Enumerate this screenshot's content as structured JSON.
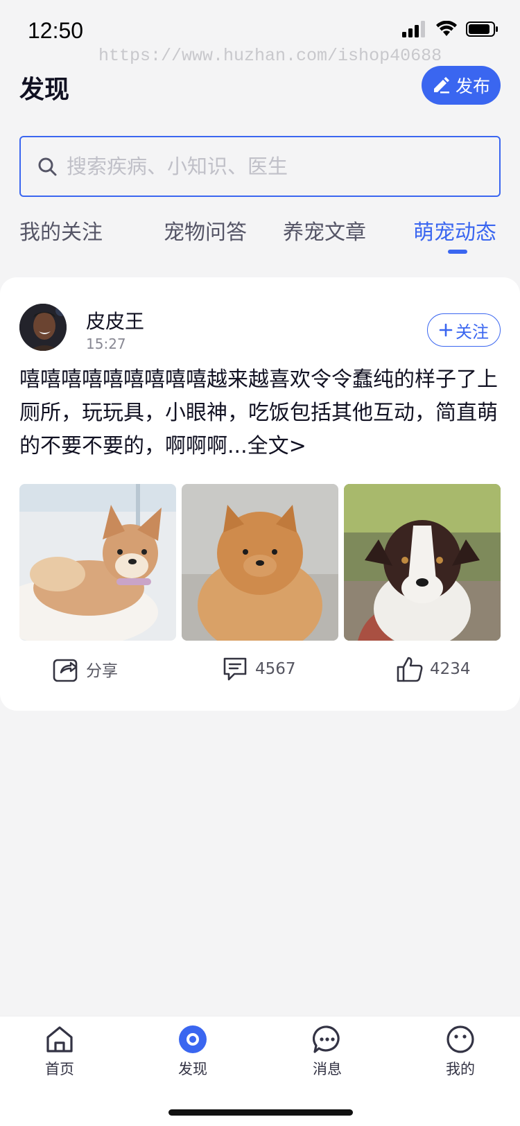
{
  "status_bar": {
    "time": "12:50"
  },
  "watermark": "https://www.huzhan.com/ishop40688",
  "header": {
    "title": "发现",
    "publish_label": "发布"
  },
  "search": {
    "placeholder": "搜索疾病、小知识、医生"
  },
  "tabs": [
    {
      "label": "我的关注",
      "active": false
    },
    {
      "label": "宠物问答",
      "active": false
    },
    {
      "label": "养宠文章",
      "active": false
    },
    {
      "label": "萌宠动态",
      "active": true
    }
  ],
  "post": {
    "author": "皮皮王",
    "time": "15:27",
    "follow_label": "关注",
    "text": "嘻嘻嘻嘻嘻嘻嘻嘻嘻越来越喜欢令令蠢纯的样子了上厕所，玩玩具，小眼神，吃饭包括其他互动，简直萌的不要不要的，啊啊啊...",
    "more_label": "全文>",
    "share_label": "分享",
    "comments": "4567",
    "likes": "4234"
  },
  "nav": {
    "items": [
      {
        "label": "首页",
        "icon": "home-icon"
      },
      {
        "label": "发现",
        "icon": "discover-icon",
        "active": true
      },
      {
        "label": "消息",
        "icon": "message-icon"
      },
      {
        "label": "我的",
        "icon": "profile-icon"
      }
    ]
  },
  "colors": {
    "accent": "#3a66f0",
    "background": "#f4f4f5"
  }
}
